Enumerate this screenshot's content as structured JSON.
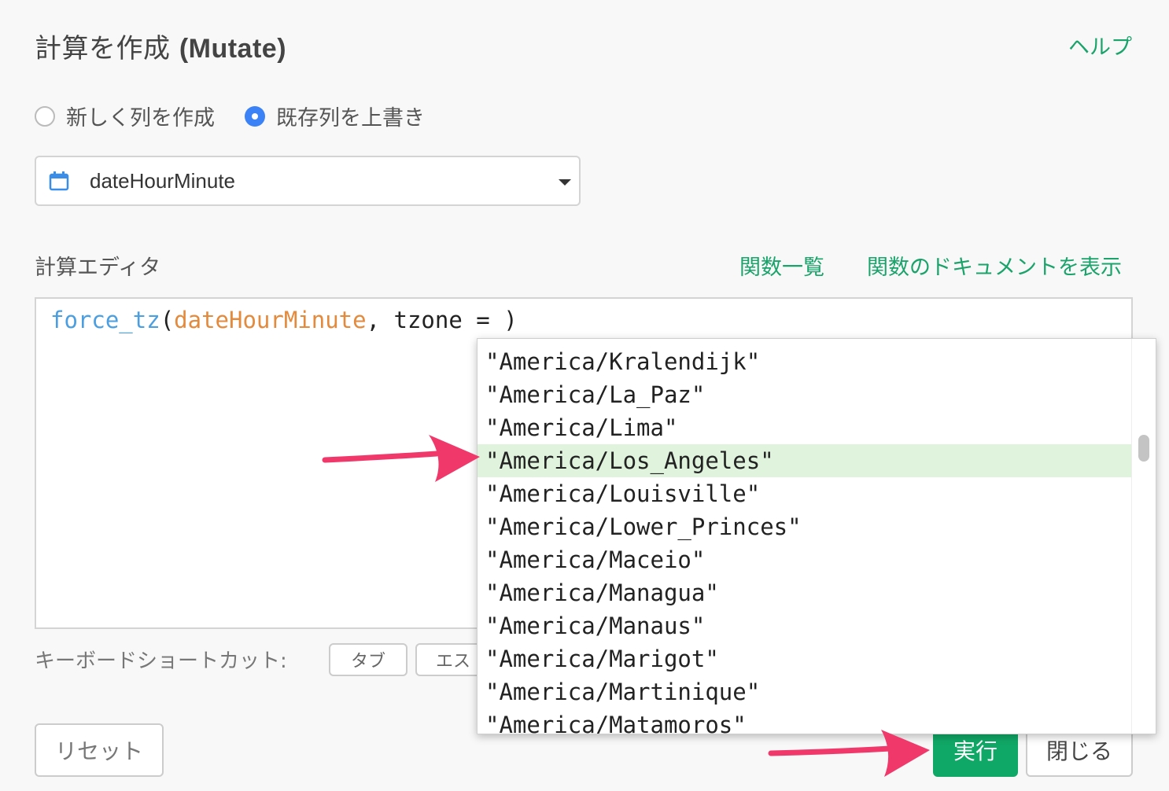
{
  "dialog": {
    "title_ja": "計算を作成",
    "title_en": "(Mutate)",
    "help_link": "ヘルプ"
  },
  "mode": {
    "options": [
      {
        "label": "新しく列を作成",
        "checked": false
      },
      {
        "label": "既存列を上書き",
        "checked": true
      }
    ]
  },
  "column_select": {
    "icon": "calendar-icon",
    "value": "dateHourMinute"
  },
  "editor": {
    "label": "計算エディタ",
    "function_list_link": "関数一覧",
    "function_docs_link": "関数のドキュメントを表示",
    "code": {
      "fn": "force_tz",
      "open": "(",
      "column": "dateHourMinute",
      "rest": ", tzone = )"
    }
  },
  "autocomplete": {
    "items": [
      "\"America/Kralendijk\"",
      "\"America/La_Paz\"",
      "\"America/Lima\"",
      "\"America/Los_Angeles\"",
      "\"America/Louisville\"",
      "\"America/Lower_Princes\"",
      "\"America/Maceio\"",
      "\"America/Managua\"",
      "\"America/Manaus\"",
      "\"America/Marigot\"",
      "\"America/Martinique\"",
      "\"America/Matamoros\""
    ],
    "selected_index": 3
  },
  "shortcuts": {
    "label": "キーボードショートカット:",
    "keys": [
      "タブ",
      "エス"
    ]
  },
  "footer": {
    "reset": "リセット",
    "run": "実行",
    "close": "閉じる"
  },
  "colors": {
    "accent_green": "#10a866",
    "link_green": "#1aa36a",
    "radio_blue": "#3b82f6",
    "annotation_arrow": "#f0386b",
    "selected_row": "#dff3dd"
  }
}
